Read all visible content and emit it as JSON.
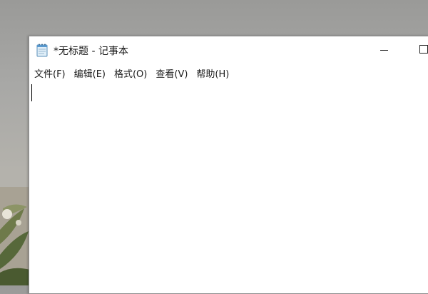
{
  "window": {
    "title": "*无标题 - 记事本",
    "app_icon": "notepad-icon",
    "controls": [
      "minimize-icon",
      "maximize-icon"
    ]
  },
  "menubar": {
    "items": [
      {
        "label": "文件(F)"
      },
      {
        "label": "编辑(E)"
      },
      {
        "label": "格式(O)"
      },
      {
        "label": "查看(V)"
      },
      {
        "label": "帮助(H)"
      }
    ]
  },
  "editor": {
    "text": ""
  }
}
